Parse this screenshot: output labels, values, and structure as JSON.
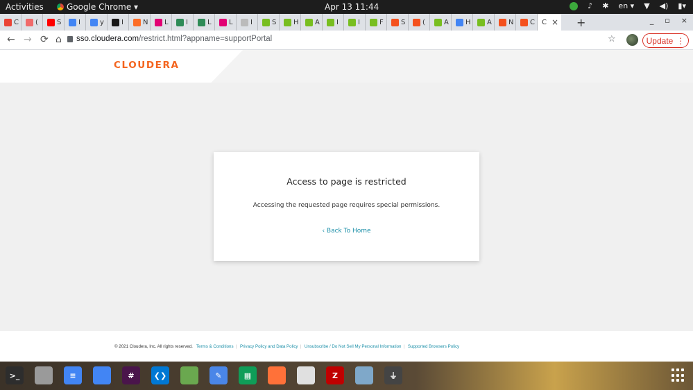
{
  "os_bar": {
    "activities": "Activities",
    "app_name": "Google Chrome ▾",
    "clock": "Apr 13  11:44",
    "language": "en ▾"
  },
  "tabs": [
    {
      "label": "C",
      "icon": "gmail-icon",
      "color": "#ea4335"
    },
    {
      "label": "(",
      "icon": "asana-icon",
      "color": "#f06a6a"
    },
    {
      "label": "S",
      "icon": "youtube-icon",
      "color": "#ff0000"
    },
    {
      "label": "I",
      "icon": "google-icon",
      "color": "#4285f4"
    },
    {
      "label": "y",
      "icon": "google-icon",
      "color": "#4285f4"
    },
    {
      "label": "I",
      "icon": "anthropic-icon",
      "color": "#191919"
    },
    {
      "label": "N",
      "icon": "gitlab-icon",
      "color": "#fc6d26"
    },
    {
      "label": "L",
      "icon": "tmobile-icon",
      "color": "#e20074"
    },
    {
      "label": "I",
      "icon": "mask-icon",
      "color": "#2e8b57"
    },
    {
      "label": "L",
      "icon": "mask-icon",
      "color": "#2e8b57"
    },
    {
      "label": "L",
      "icon": "tmobile-icon",
      "color": "#e20074"
    },
    {
      "label": "I",
      "icon": "doc-icon",
      "color": "#bbbbbb"
    },
    {
      "label": "S",
      "icon": "elephant-icon",
      "color": "#78be20"
    },
    {
      "label": "H",
      "icon": "elephant-icon",
      "color": "#78be20"
    },
    {
      "label": "A",
      "icon": "elephant-icon",
      "color": "#78be20"
    },
    {
      "label": "I",
      "icon": "elephant-icon",
      "color": "#78be20"
    },
    {
      "label": "I",
      "icon": "elephant-icon",
      "color": "#78be20"
    },
    {
      "label": "F",
      "icon": "elephant-icon",
      "color": "#78be20"
    },
    {
      "label": "S",
      "icon": "cloudera-icon",
      "color": "#f4511e"
    },
    {
      "label": "(",
      "icon": "cloudera-icon",
      "color": "#f4511e"
    },
    {
      "label": "A",
      "icon": "elephant-icon",
      "color": "#78be20"
    },
    {
      "label": "H",
      "icon": "google-icon",
      "color": "#4285f4"
    },
    {
      "label": "A",
      "icon": "elephant-icon",
      "color": "#78be20"
    },
    {
      "label": "N",
      "icon": "cloudera-icon",
      "color": "#f4511e"
    },
    {
      "label": "C",
      "icon": "cloudera-icon",
      "color": "#f4511e"
    }
  ],
  "active_tab": {
    "label": "C",
    "close": "×"
  },
  "new_tab": "+",
  "window_controls": [
    "_",
    "▫",
    "×"
  ],
  "address_bar": {
    "host": "sso.cloudera.com",
    "path": "/restrict.html?appname=supportPortal"
  },
  "toolbar": {
    "back": "←",
    "forward": "→",
    "reload": "⟳",
    "home": "⌂",
    "bookmark": "☆",
    "update_label": "Update",
    "menu": "⋮"
  },
  "brand": {
    "logo": "CLOUDERA",
    "accent": "#f4651f"
  },
  "card": {
    "title": "Access to page is restricted",
    "message": "Accessing the requested page requires special permissions.",
    "back_link": "Back To Home",
    "back_chevron": "‹",
    "link_color": "#1b8fa8"
  },
  "footer": {
    "copyright": "© 2021 Cloudera, Inc. All rights reserved.",
    "links": [
      "Terms & Conditions",
      "Privacy Policy and Data Policy",
      "Unsubscribe / Do Not Sell My Personal Information",
      "Supported Browsers Policy"
    ]
  },
  "dock": [
    {
      "name": "terminal-icon",
      "color": "#2d2d2d",
      "glyph": ">_"
    },
    {
      "name": "files-icon",
      "color": "#9a9a9a",
      "glyph": ""
    },
    {
      "name": "docs-icon",
      "color": "#4285f4",
      "glyph": "≡"
    },
    {
      "name": "chrome-icon",
      "color": "#4285f4",
      "glyph": ""
    },
    {
      "name": "slack-icon",
      "color": "#4a154b",
      "glyph": "#"
    },
    {
      "name": "vscode-icon",
      "color": "#0078d4",
      "glyph": "❮❯"
    },
    {
      "name": "image-viewer-icon",
      "color": "#6aa84f",
      "glyph": ""
    },
    {
      "name": "text-editor-icon",
      "color": "#4a86e8",
      "glyph": "✎"
    },
    {
      "name": "sheets-icon",
      "color": "#0f9d58",
      "glyph": "▦"
    },
    {
      "name": "firefox-icon",
      "color": "#ff7139",
      "glyph": ""
    },
    {
      "name": "document-viewer-icon",
      "color": "#e0e0e0",
      "glyph": ""
    },
    {
      "name": "filezilla-icon",
      "color": "#bf0000",
      "glyph": "Z"
    },
    {
      "name": "network-icon",
      "color": "#7fa8c9",
      "glyph": ""
    },
    {
      "name": "usb-icon",
      "color": "#444444",
      "glyph": "⏚"
    }
  ]
}
